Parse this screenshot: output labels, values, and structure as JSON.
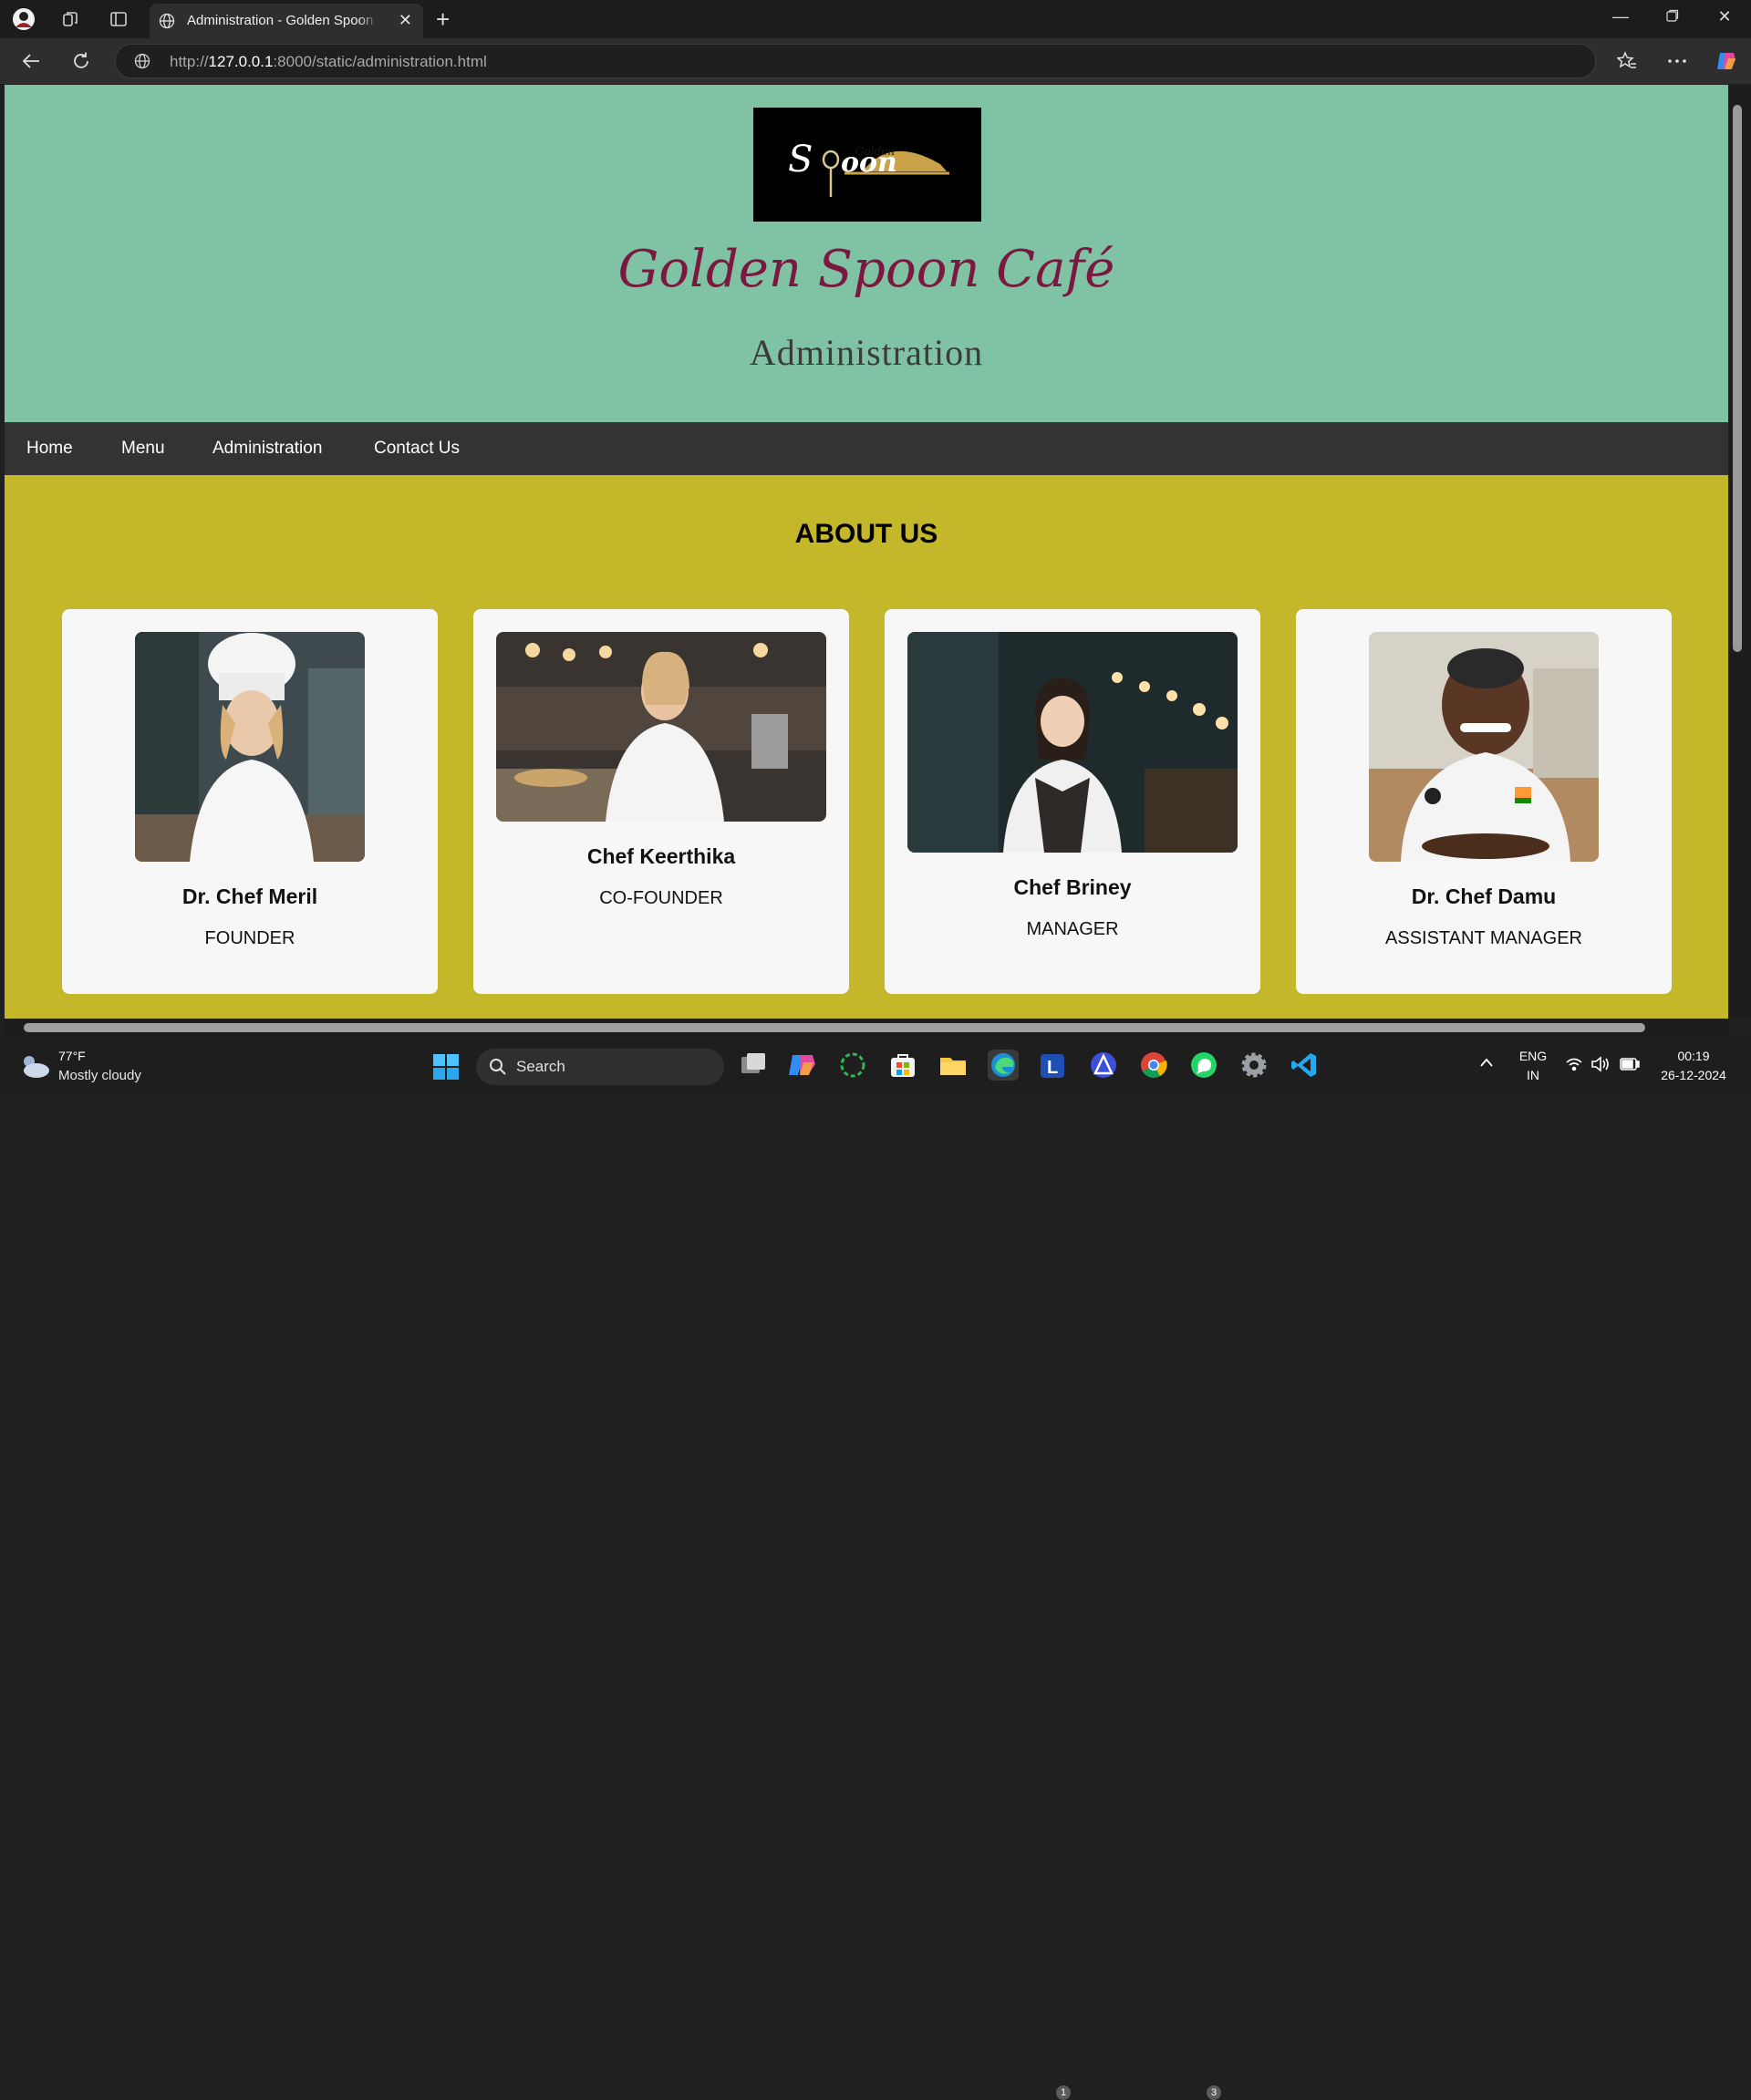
{
  "browser": {
    "tab_title": "Administration - Golden Spoon Café",
    "url_prefix": "http://",
    "url_host": "127.0.0.1",
    "url_rest": ":8000/static/administration.html"
  },
  "site": {
    "logo_alt": "Golden Spoon",
    "title": "Golden Spoon Café",
    "page_heading": "Administration",
    "nav": [
      "Home",
      "Menu",
      "Administration",
      "Contact Us"
    ],
    "section_heading": "ABOUT US",
    "team": [
      {
        "name": "Dr. Chef Meril",
        "role": "FOUNDER"
      },
      {
        "name": "Chef Keerthika",
        "role": "CO-FOUNDER"
      },
      {
        "name": "Chef Briney",
        "role": "MANAGER"
      },
      {
        "name": "Dr. Chef Damu",
        "role": "ASSISTANT MANAGER"
      }
    ]
  },
  "taskbar": {
    "weather_temp": "77°F",
    "weather_condition": "Mostly cloudy",
    "search_label": "Search",
    "badges": {
      "lexis": "1",
      "whatsapp": "3"
    },
    "language": "ENG",
    "region": "IN",
    "time": "00:19",
    "date": "26-12-2024"
  },
  "colors": {
    "hero_bg": "#80c3a4",
    "content_bg": "#c4b72a",
    "nav_bg": "#333333",
    "title_color": "#7a1840"
  }
}
